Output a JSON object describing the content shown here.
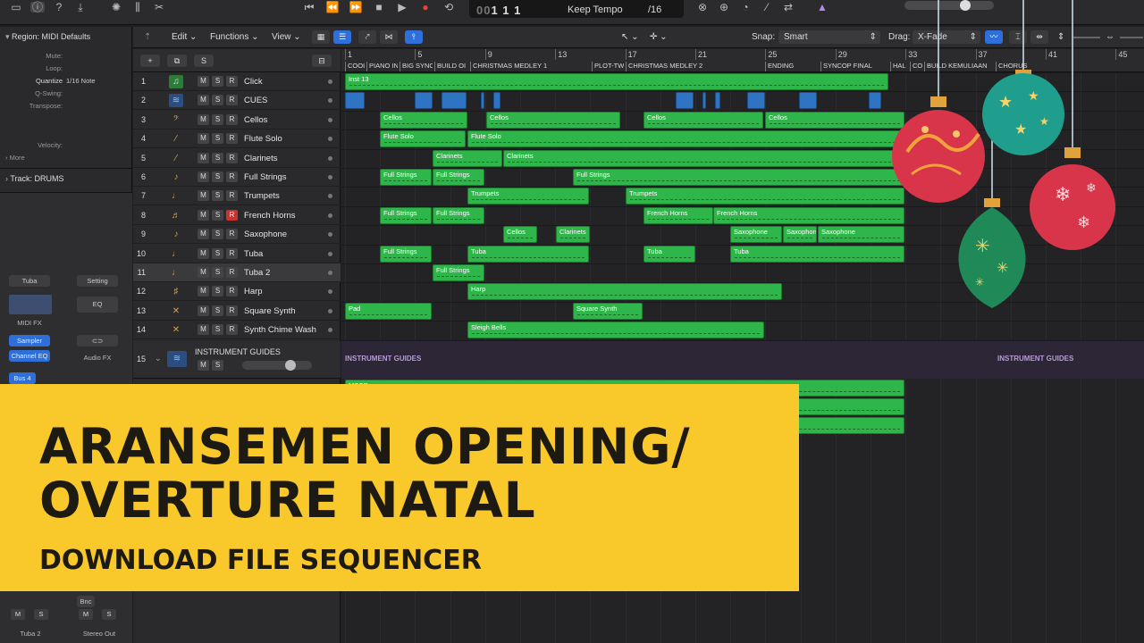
{
  "lcd": {
    "position": "1 1 1",
    "bar_prefix": "00",
    "beat_prefix": "00",
    "tempo_mode": "Keep Tempo",
    "division": "/16"
  },
  "inspector": {
    "region_title": "Region: MIDI Defaults",
    "rows": [
      {
        "key": "Mute:",
        "value": ""
      },
      {
        "key": "Loop:",
        "value": ""
      },
      {
        "key": "Quantize",
        "value": "1/16 Note"
      },
      {
        "key": "Q-Swing:",
        "value": ""
      },
      {
        "key": "Transpose:",
        "value": ""
      },
      {
        "key": "Velocity:",
        "value": ""
      }
    ],
    "more_label": "More",
    "track_title": "Track: DRUMS",
    "strip_left": {
      "name_label": "Tuba",
      "midi_fx": "MIDI FX",
      "instrument": "Sampler",
      "eq": "Channel EQ",
      "send": "Bus 4",
      "footer": "Tuba 2"
    },
    "strip_right": {
      "setting": "Setting",
      "eq": "EQ",
      "audio_fx": "Audio FX",
      "bnc": "Bnc",
      "footer": "Stereo Out"
    },
    "mute": "M",
    "solo": "S"
  },
  "toolbar": {
    "edit": "Edit",
    "functions": "Functions",
    "view": "View",
    "snap_label": "Snap:",
    "snap_value": "Smart",
    "drag_label": "Drag:",
    "drag_value": "X-Fade"
  },
  "header_top": {
    "add": "+",
    "solo": "S"
  },
  "tracks": [
    {
      "num": "1",
      "name": "Click",
      "icon": "note-icon",
      "rec": false
    },
    {
      "num": "2",
      "name": "CUES",
      "icon": "waveform-icon",
      "rec": false
    },
    {
      "num": "3",
      "name": "Cellos",
      "icon": "cello-icon",
      "rec": false
    },
    {
      "num": "4",
      "name": "Flute Solo",
      "icon": "flute-icon",
      "rec": false
    },
    {
      "num": "5",
      "name": "Clarinets",
      "icon": "clarinet-icon",
      "rec": false
    },
    {
      "num": "6",
      "name": "Full Strings",
      "icon": "violin-icon",
      "rec": false
    },
    {
      "num": "7",
      "name": "Trumpets",
      "icon": "trumpet-icon",
      "rec": false
    },
    {
      "num": "8",
      "name": "French Horns",
      "icon": "horn-icon",
      "rec": true
    },
    {
      "num": "9",
      "name": "Saxophone",
      "icon": "saxophone-icon",
      "rec": false
    },
    {
      "num": "10",
      "name": "Tuba",
      "icon": "tuba-icon",
      "rec": false
    },
    {
      "num": "11",
      "name": "Tuba 2",
      "icon": "tuba-icon",
      "rec": false
    },
    {
      "num": "12",
      "name": "Harp",
      "icon": "harp-icon",
      "rec": false
    },
    {
      "num": "13",
      "name": "Square Synth",
      "icon": "synth-icon",
      "rec": false
    },
    {
      "num": "14",
      "name": "Synth Chime Wash",
      "icon": "synth-icon",
      "rec": false
    }
  ],
  "track_buttons": {
    "m": "M",
    "s": "S",
    "r": "R"
  },
  "folder": {
    "num": "15",
    "name": "INSTRUMENT GUIDES"
  },
  "ruler": {
    "bars": [
      "1",
      "5",
      "9",
      "13",
      "17",
      "21",
      "25",
      "29",
      "33",
      "37",
      "41",
      "45"
    ],
    "markers": [
      {
        "label": "COOL"
      },
      {
        "label": "PIANO INTRO"
      },
      {
        "label": "BIG SYNC"
      },
      {
        "label": "BUILD OI"
      },
      {
        "label": "CHRISTMAS MEDLEY 1"
      },
      {
        "label": "PLOT-TWIST"
      },
      {
        "label": "CHRISTMAS MEDLEY 2"
      },
      {
        "label": "ENDING"
      },
      {
        "label": "SYNCOP FINAL"
      },
      {
        "label": "HAL"
      },
      {
        "label": "COD"
      },
      {
        "label": "BUILD KEMULIAAN"
      },
      {
        "label": "CHORUS"
      }
    ]
  },
  "regions": {
    "r1": "Inst 13",
    "r3a": "Cellos",
    "r3b": "Cellos",
    "r3c": "Cellos",
    "r3d": "Cellos",
    "r4a": "Flute Solo",
    "r4b": "Flute Solo",
    "r5a": "Clarinets",
    "r5b": "Clarinets",
    "r6a": "Full Strings",
    "r6b": "Full Strings",
    "r6c": "Full Strings",
    "r7a": "Trumpets",
    "r7b": "Trumpets",
    "r8a": "Full Strings",
    "r8b": "Full Strings",
    "r8c": "French Horns",
    "r8d": "French Horns",
    "r9a": "Cellos",
    "r9b": "Clarinets",
    "r9c": "Saxophone",
    "r9d": "Saxophone",
    "r9e": "Saxophone",
    "r10a": "Full Strings",
    "r10b": "Tuba",
    "r10c": "Tuba",
    "r10d": "Tuba",
    "r11a": "Full Strings",
    "r12a": "Harp",
    "r13a": "Pad",
    "r13b": "Square Synth",
    "r14a": "Sleigh Bells",
    "guides_label": "INSTRUMENT GUIDES",
    "guides_label_2": "INSTRUMENT GUIDES",
    "bottom_region": "MSCR"
  },
  "banner": {
    "line1": "ARANSEMEN OPENING/",
    "line2": "OVERTURE NATAL",
    "subtitle": "DOWNLOAD FILE SEQUENCER"
  },
  "colors": {
    "region": "#2fb64a",
    "banner": "#f9c82a",
    "banner_text": "#1d1a14",
    "accent": "#2f6fd9",
    "record": "#c8342d"
  }
}
